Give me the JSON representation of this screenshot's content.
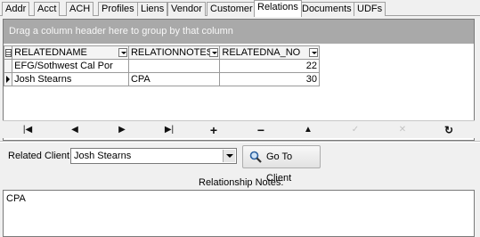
{
  "tabs": [
    {
      "label": "Addr",
      "active": false
    },
    {
      "label": "Acct",
      "active": false
    },
    {
      "label": "ACH",
      "active": false
    },
    {
      "label": "Profiles",
      "active": false
    },
    {
      "label": "Liens",
      "active": false
    },
    {
      "label": "Vendor",
      "active": false
    },
    {
      "label": "Customer",
      "active": false
    },
    {
      "label": "Relations",
      "active": true
    },
    {
      "label": "Documents",
      "active": false
    },
    {
      "label": "UDFs",
      "active": false
    }
  ],
  "grid": {
    "group_hint": "Drag a column header here to group by that column",
    "columns": [
      "RELATEDNAME",
      "RELATIONNOTES",
      "RELATEDNA_NO"
    ],
    "rows": [
      {
        "name": "EFG/Sothwest Cal Por",
        "notes": "",
        "no": "22",
        "current": false
      },
      {
        "name": "Josh Stearns",
        "notes": "CPA",
        "no": "30",
        "current": true
      }
    ]
  },
  "navigator": {
    "first": "first-record",
    "prior": "prior-record",
    "next": "next-record",
    "last": "last-record",
    "insert": "insert-record",
    "delete": "delete-record",
    "edit": "edit-record",
    "post": "post-record",
    "cancel": "cancel-edit",
    "refresh": "refresh-data"
  },
  "related_client": {
    "label": "Related Client:",
    "value": "Josh Stearns",
    "button": "Go To Client"
  },
  "notes": {
    "label": "Relationship Notes:",
    "value": "CPA"
  },
  "colors": {
    "group_bar": "#a9a9a9",
    "panel_border": "#7a7a7a",
    "disabled": "#c3c3c3"
  }
}
